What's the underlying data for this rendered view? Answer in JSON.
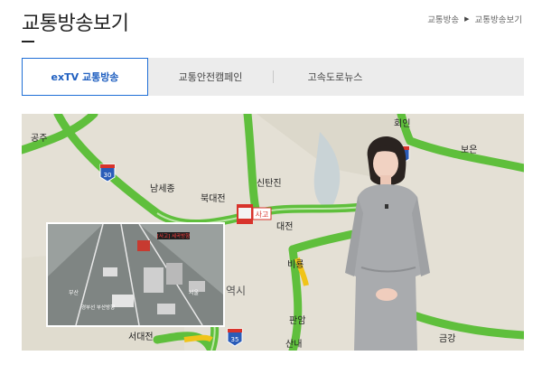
{
  "page": {
    "title": "교통방송보기"
  },
  "breadcrumb": {
    "items": [
      "교통방송",
      "교통방송보기"
    ]
  },
  "tabs": [
    {
      "label": "exTV 교통방송",
      "active": true
    },
    {
      "label": "교통안전캠페인",
      "active": false
    },
    {
      "label": "고속도로뉴스",
      "active": false
    }
  ],
  "video": {
    "map_labels": [
      "공주",
      "남세종",
      "북대전",
      "신탄진",
      "회인",
      "보은",
      "대전",
      "비룡",
      "판암",
      "서대전",
      "산내",
      "금강",
      "역시"
    ],
    "route_shields": [
      "30",
      "35",
      "25"
    ],
    "incident_label": "사고",
    "inset": {
      "banner": "[사고] 세곡방향",
      "direction_left": "부산",
      "direction_right": "서울",
      "caption": "경부선 부산방향"
    }
  },
  "colors": {
    "accent": "#1f6fd6",
    "road": "#5fbf3c",
    "map_bg": "#e6e2d8"
  }
}
